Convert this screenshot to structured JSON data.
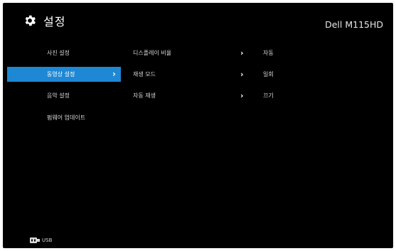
{
  "header": {
    "icon": "gear-icon",
    "title": "설정",
    "model": "Dell M115HD"
  },
  "menu": [
    {
      "label": "사진 설정",
      "active": false
    },
    {
      "label": "동영상 설정",
      "active": true,
      "chevron": "›"
    },
    {
      "label": "음악 설정",
      "active": false
    },
    {
      "label": "펌웨어 업데이트",
      "active": false
    }
  ],
  "submenu": [
    {
      "label": "디스플레이 비율",
      "chevron": "›",
      "value": "자동"
    },
    {
      "label": "재생 모드",
      "chevron": "›",
      "value": "일회"
    },
    {
      "label": "자동 재생",
      "chevron": "›",
      "value": "끄기"
    }
  ],
  "footer": {
    "icon": "usb-icon",
    "label": "USB"
  },
  "colors": {
    "background": "#000000",
    "highlight": "#1e88d4",
    "text": "#d9d9d9"
  }
}
